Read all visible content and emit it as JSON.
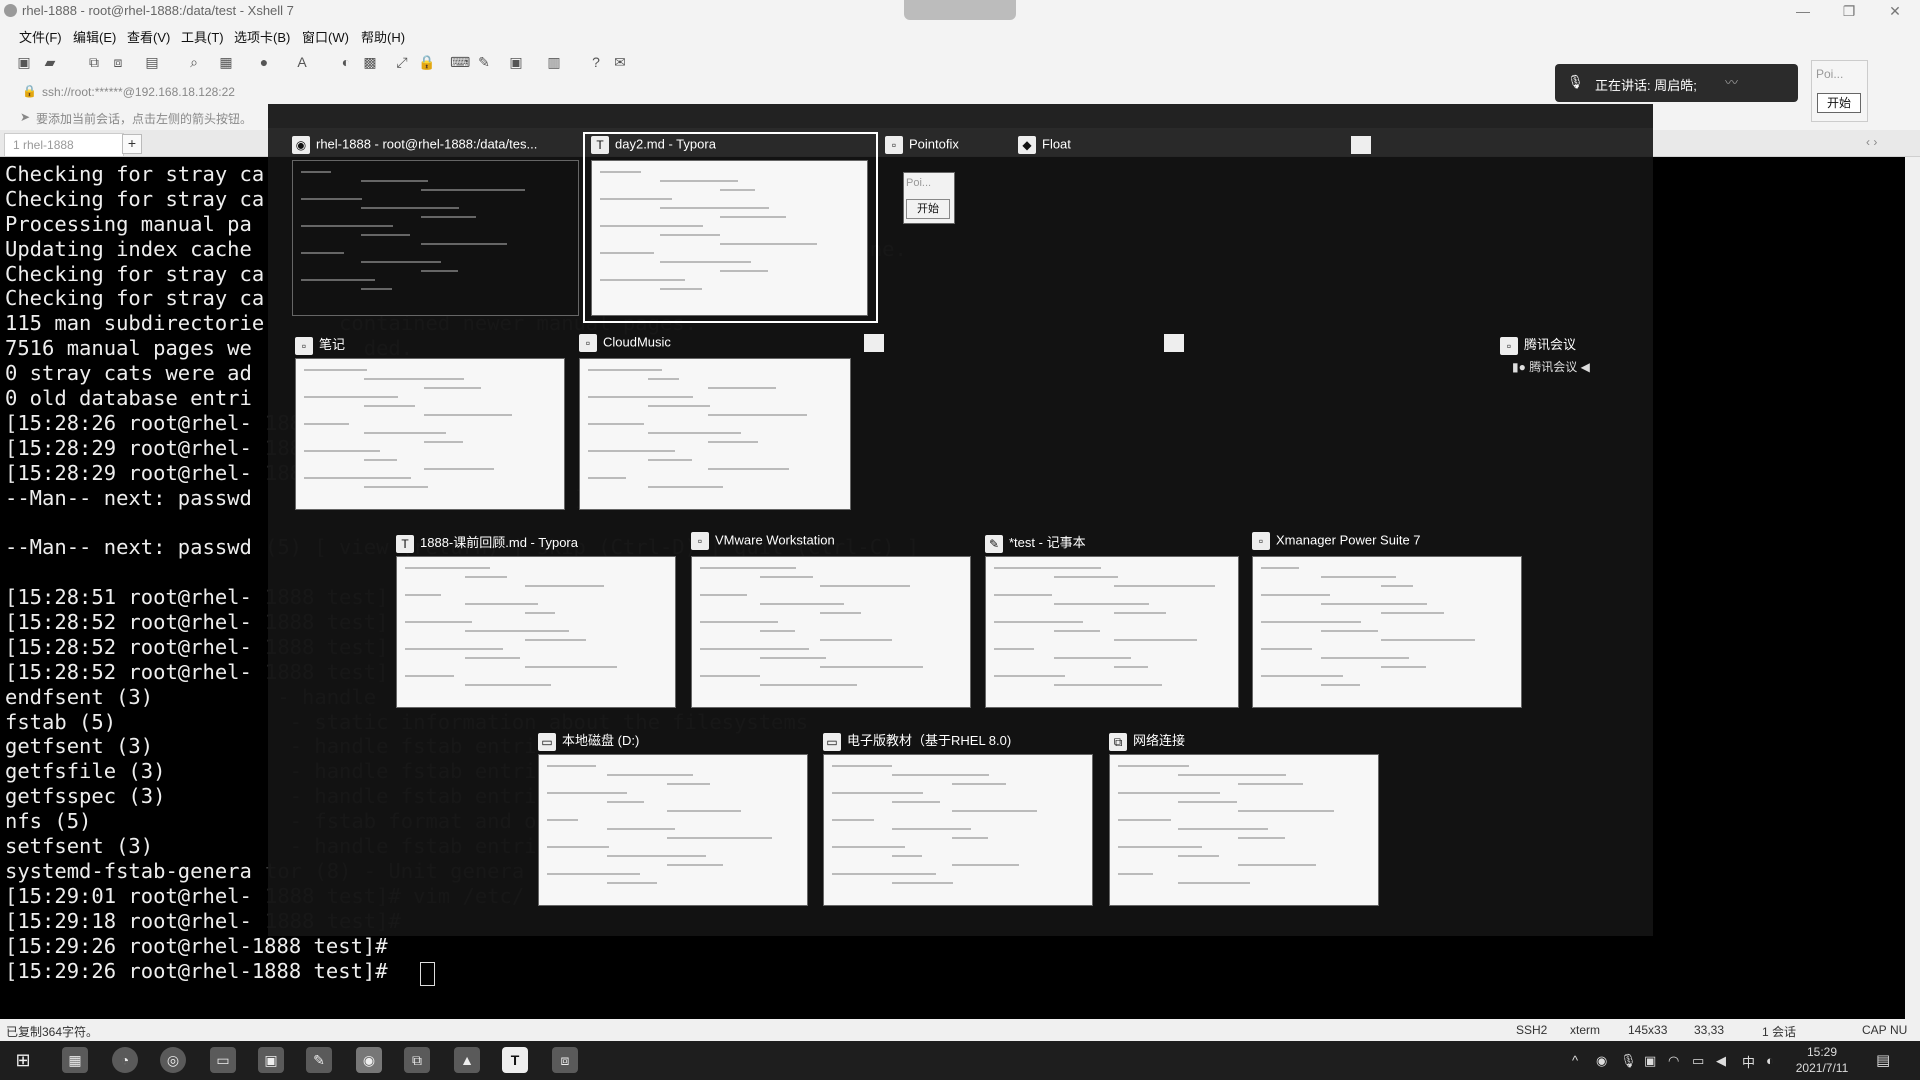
{
  "window": {
    "title": "rhel-1888 - root@rhel-1888:/data/test - Xshell 7",
    "controls": {
      "min": "—",
      "max": "❐",
      "close": "✕"
    }
  },
  "menu": [
    "文件(F)",
    "编辑(E)",
    "查看(V)",
    "工具(T)",
    "选项卡(B)",
    "窗口(W)",
    "帮助(H)"
  ],
  "address": "ssh://root:******@192.168.18.128:22",
  "hint": "要添加当前会话，点击左侧的箭头按钮。",
  "tab": {
    "label": "1 rhel-1888",
    "plus": "+"
  },
  "terminal_lines": [
    "Checking for stray ca",
    "Checking for stray ca",
    "Processing manual pa",
    "Updating index cache",
    "Checking for stray ca",
    "Checking for stray ca",
    "115 man subdirectorie",
    "7516 manual pages we",
    "0 stray cats were ad",
    "0 old database entri",
    "[15:28:26 root@rhel-",
    "[15:28:29 root@rhel-",
    "[15:28:29 root@rhel-",
    "--Man-- next: passwd",
    "",
    "--Man-- next: passwd",
    "",
    "[15:28:51 root@rhel-",
    "[15:28:52 root@rhel-",
    "[15:28:52 root@rhel-",
    "[15:28:52 root@rhel-",
    "endfsent (3)",
    "fstab (5)",
    "getfsent (3)",
    "getfsfile (3)",
    "getfsspec (3)",
    "nfs (5)",
    "setfsent (3)",
    "systemd-fstab-genera",
    "[15:29:01 root@rhel-",
    "[15:29:18 root@rhel-",
    "[15:29:26 root@rhel-1888 test]#",
    "[15:29:26 root@rhel-1888 test]# "
  ],
  "terminal_faded": [
    "",
    "",
    "",
    "                   f                            one.",
    "",
    "",
    "      contained newer manual pages.",
    "        ded.",
    "",
    "",
    "1888",
    "1888",
    "1888",
    "           quit (Ctrl-C) ]",
    "",
    "(5) [ view (return) | skip (Ctrl-D) | quit (Ctrl-C) ]",
    "",
    "1888 test]",
    "1888 test]",
    "1888 test]",
    "1888 test]",
    " - handle",
    "  - static information about the filesystems",
    "  - handle fstab entri",
    "  - handle fstab entri",
    "  - handle fstab entri",
    "  - fstab format and o",
    "  - handle fstab entri",
    "tor (8) - Unit genera",
    "1888 test]# vim /etc/",
    "1888 test]#"
  ],
  "status": {
    "left": "已复制364字符。",
    "ssh": "SSH2",
    "term": "xterm",
    "size": "145x33",
    "pos": "33,33",
    "sessions": "1 会话",
    "cap": "CAP",
    "num": "NU"
  },
  "taskview": [
    {
      "title": "rhel-1888 - root@rhel-1888:/data/tes...",
      "icon": "xshell-icon",
      "dark": true
    },
    {
      "title": "day2.md - Typora",
      "icon": "typora-icon",
      "dark": false
    },
    {
      "title": "Pointofix",
      "icon": "window-icon"
    },
    {
      "title": "Float",
      "icon": "window-icon"
    },
    {
      "title": "笔记",
      "icon": "window-icon"
    },
    {
      "title": "CloudMusic",
      "icon": "window-icon"
    },
    {
      "title": "腾讯会议",
      "icon": "window-icon"
    },
    {
      "title": "1888-课前回顾.md - Typora",
      "icon": "typora-icon"
    },
    {
      "title": "VMware Workstation",
      "icon": "window-icon"
    },
    {
      "title": "*test - 记事本",
      "icon": "notepad-icon"
    },
    {
      "title": "Xmanager Power Suite 7",
      "icon": "window-icon"
    },
    {
      "title": "本地磁盘 (D:)",
      "icon": "folder-icon"
    },
    {
      "title": "电子版教材（基于RHEL 8.0)",
      "icon": "folder-icon"
    },
    {
      "title": "网络连接",
      "icon": "network-icon"
    }
  ],
  "pointofix": {
    "placeholder": "Poi...",
    "button": "开始"
  },
  "tencent_sub": "腾讯会议",
  "meeting": {
    "speaking": "正在讲话: 周启皓;"
  },
  "clock": {
    "time": "15:29",
    "date": "2021/7/11"
  },
  "tray": {
    "ime": "中"
  }
}
